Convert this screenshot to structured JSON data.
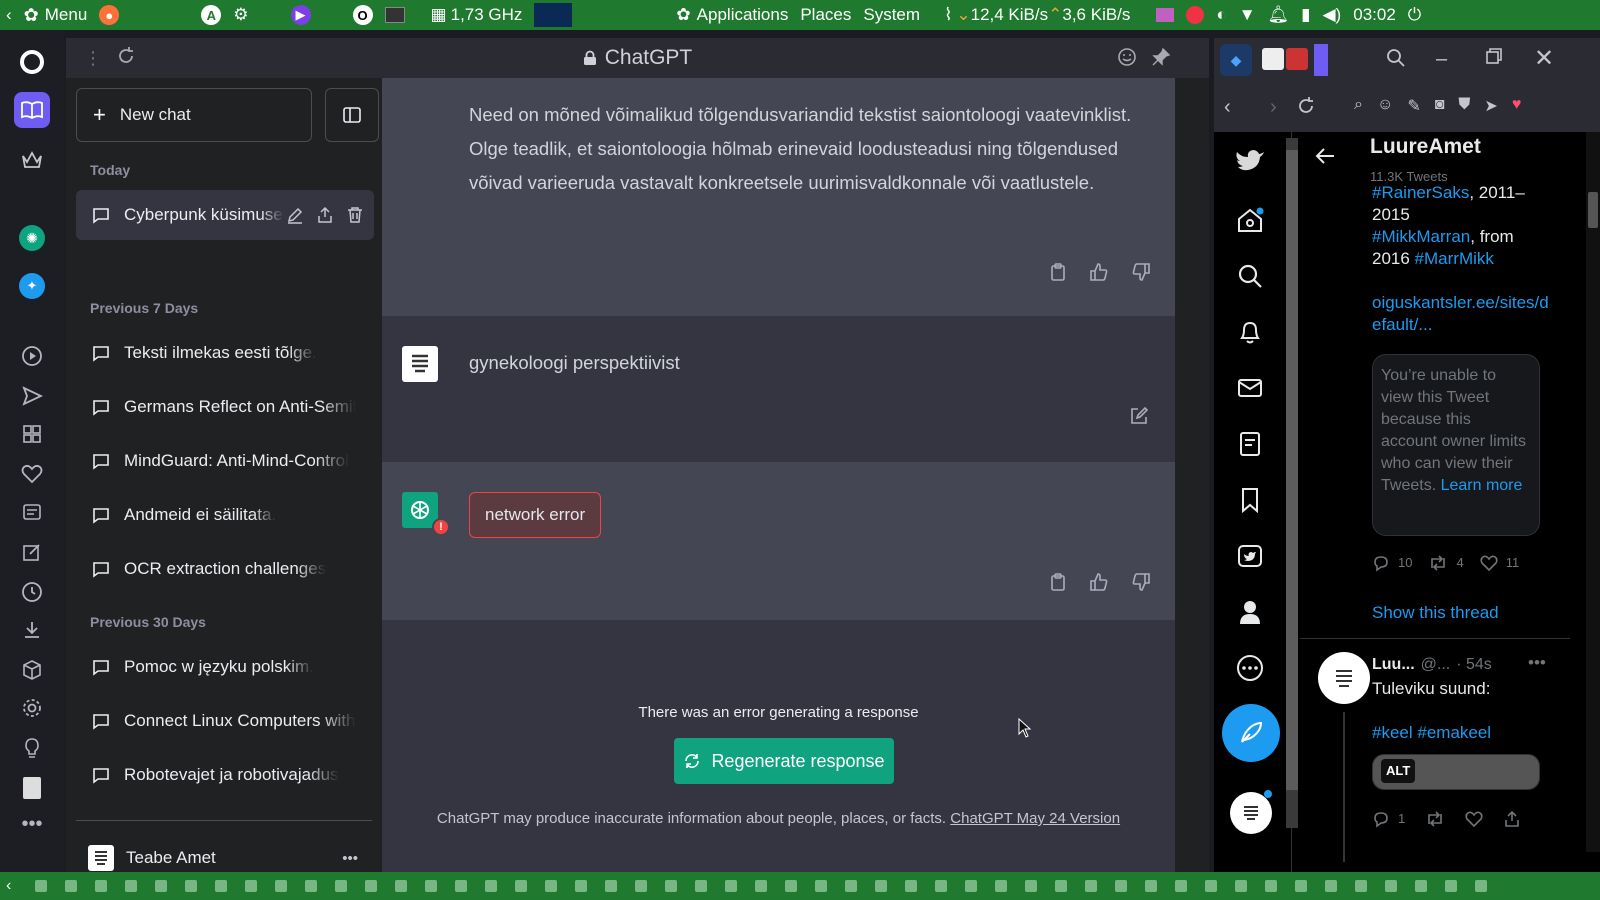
{
  "system_bar": {
    "menu_label": "Menu",
    "cpu_freq": "1,73 GHz",
    "applications": "Applications",
    "places": "Places",
    "system": "System",
    "net_down": "12,4 KiB/s",
    "net_up": "3,6 KiB/s",
    "clock": "03:02"
  },
  "window": {
    "title": "ChatGPT"
  },
  "sidebar": {
    "new_chat": "New chat",
    "section_today": "Today",
    "section_7days": "Previous 7 Days",
    "section_30days": "Previous 30 Days",
    "today_items": [
      {
        "label": "Cyberpunk küsimused"
      }
    ],
    "week_items": [
      {
        "label": "Teksti ilmekas eesti tõlge."
      },
      {
        "label": "Germans Reflect on Anti-Semitism"
      },
      {
        "label": "MindGuard: Anti-Mind-Control"
      },
      {
        "label": "Andmeid ei säilitata."
      },
      {
        "label": "OCR extraction challenges"
      }
    ],
    "month_items": [
      {
        "label": "Pomoc w języku polskim."
      },
      {
        "label": "Connect Linux Computers with"
      },
      {
        "label": "Robotevajet ja robotivajadus"
      }
    ],
    "profile_name": "Teabe Amet"
  },
  "chat": {
    "ai_message_1": "Need on mõned võimalikud tõlgendusvariandid tekstist saiontoloogi vaatevinklist. Olge teadlik, et saiontoloogia hõlmab erinevaid loodusteadusi ning tõlgendused võivad varieeruda vastavalt konkreetsele uurimisvaldkonnale või vaatlustele.",
    "user_message": "gynekoloogi perspektiivist",
    "error_message": "network error",
    "error_generating": "There was an error generating a response",
    "regenerate_label": "Regenerate response",
    "disclaimer": "ChatGPT may produce inaccurate information about people, places, or facts. ",
    "version_link": "ChatGPT May 24 Version"
  },
  "twitter": {
    "profile_name": "LuureAmet",
    "tweet_count": "11.3K Tweets",
    "tag_rainer": "#RainerSaks",
    "years_1": ", 2011–2015",
    "tag_mikk": "#MikkMarran",
    "from_2016": ", from 2016 ",
    "tag_marr": "#MarrMikk",
    "link": "oiguskantsler.ee/sites/default/...",
    "unavailable_text": "You’re unable to view this Tweet because this account owner limits who can view their Tweets. ",
    "learn_more": "Learn more",
    "replies_1": "10",
    "retweets_1": "4",
    "likes_1": "11",
    "show_thread": "Show this thread",
    "author_short": "Luu...",
    "handle_short": "@...",
    "time_ago": "· 54s",
    "tweet_text": "Tuleviku suund:",
    "tag_keel": "#keel",
    "tag_emakeel": "#emakeel",
    "alt_badge": "ALT",
    "replies_2": "1"
  }
}
